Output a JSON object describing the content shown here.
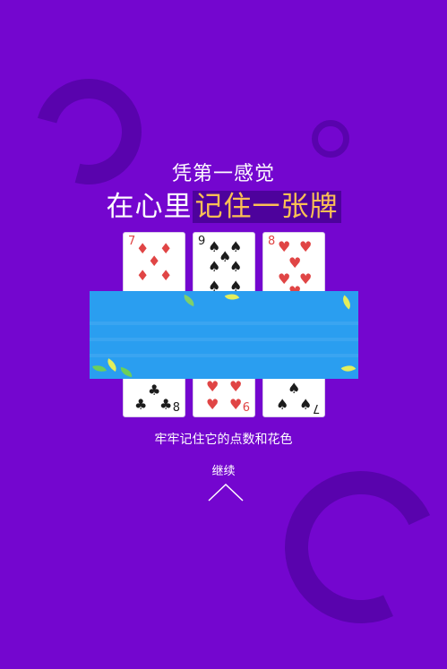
{
  "intro": {
    "subtitle": "凭第一感觉",
    "headline_prefix": "在心里",
    "headline_highlight": "记住一张牌",
    "instruction": "牢牢记住它的点数和花色",
    "continue_label": "继续"
  },
  "cards": [
    {
      "rank": "7",
      "suit": "diamond",
      "color": "red"
    },
    {
      "rank": "9",
      "suit": "spade",
      "color": "black"
    },
    {
      "rank": "8",
      "suit": "heart",
      "color": "red"
    }
  ],
  "bottom_ranks": [
    "8",
    "6",
    "7"
  ],
  "colors": {
    "background": "#7406cf",
    "highlight_text": "#fcc054",
    "card_red": "#e04545",
    "card_black": "#1c1c1c",
    "overlay_blue": "#2a9ef0"
  },
  "icons": {
    "continue_arrow": "chevron-up-icon",
    "diamond": "diamond-suit-icon",
    "spade": "spade-suit-icon",
    "heart": "heart-suit-icon",
    "club": "club-suit-icon"
  }
}
